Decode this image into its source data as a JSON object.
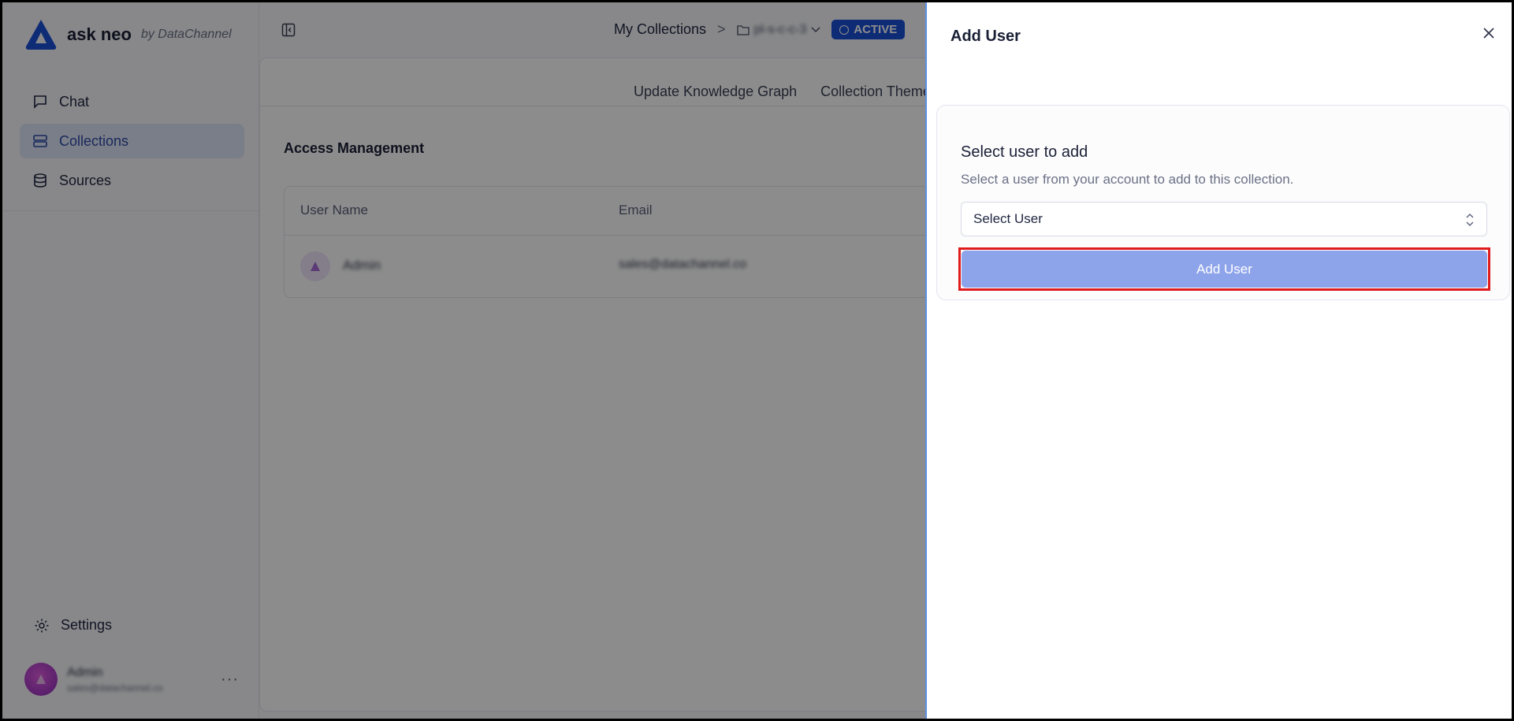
{
  "app": {
    "brand_name": "ask neo",
    "brand_by": "by DataChannel"
  },
  "sidebar": {
    "items": [
      {
        "label": "Chat",
        "icon": "chat-icon",
        "active": false
      },
      {
        "label": "Collections",
        "icon": "collections-icon",
        "active": true
      },
      {
        "label": "Sources",
        "icon": "database-icon",
        "active": false
      }
    ],
    "settings_label": "Settings",
    "profile": {
      "name": "Admin",
      "email": "sales@datachannel.co",
      "more_label": "···"
    }
  },
  "header": {
    "breadcrumb_root": "My Collections",
    "breadcrumb_sep": ">",
    "folder_name": "pl-s-c-c-3",
    "status": "ACTIVE"
  },
  "main": {
    "tabs": [
      "Update Knowledge Graph",
      "Collection Theme"
    ],
    "section_title": "Access Management",
    "table": {
      "columns": [
        "User Name",
        "Email"
      ],
      "rows": [
        {
          "name": "Admin",
          "email": "sales@datachannel.co"
        }
      ]
    }
  },
  "panel": {
    "title": "Add User",
    "close_label": "×",
    "card": {
      "heading": "Select user to add",
      "description": "Select a user from your account to add to this collection.",
      "select_placeholder": "Select User",
      "button_label": "Add User"
    }
  },
  "colors": {
    "accent": "#1b4fd8",
    "button": "#8ea4ea",
    "highlight": "#e01b1b"
  }
}
